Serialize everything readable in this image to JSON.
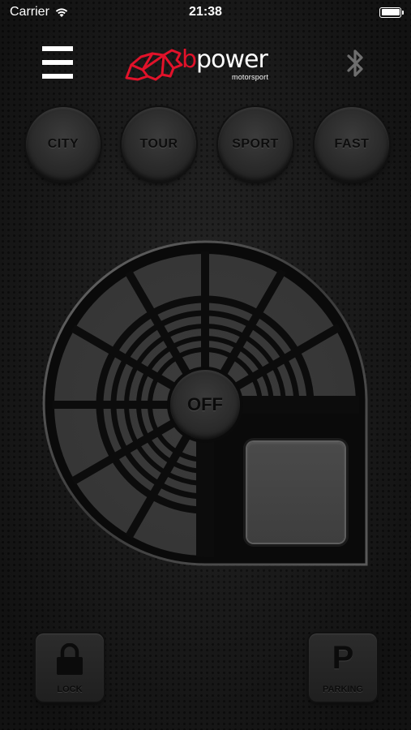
{
  "status_bar": {
    "carrier": "Carrier",
    "time": "21:38"
  },
  "header": {
    "logo_b": "b",
    "logo_rest": "power",
    "logo_sub": "motorsport",
    "menu_icon": "hamburger-icon",
    "bluetooth_icon": "bluetooth-icon"
  },
  "modes": [
    {
      "label": "CITY"
    },
    {
      "label": "TOUR"
    },
    {
      "label": "SPORT"
    },
    {
      "label": "FAST"
    }
  ],
  "dial": {
    "center_label": "OFF"
  },
  "bottom": {
    "lock_label": "LOCK",
    "lock_icon": "lock-icon",
    "parking_symbol": "P",
    "parking_label": "PARKING"
  },
  "colors": {
    "brand_red": "#e1122a",
    "background": "#1c1c1c",
    "button_text": "#0b0b0b"
  }
}
